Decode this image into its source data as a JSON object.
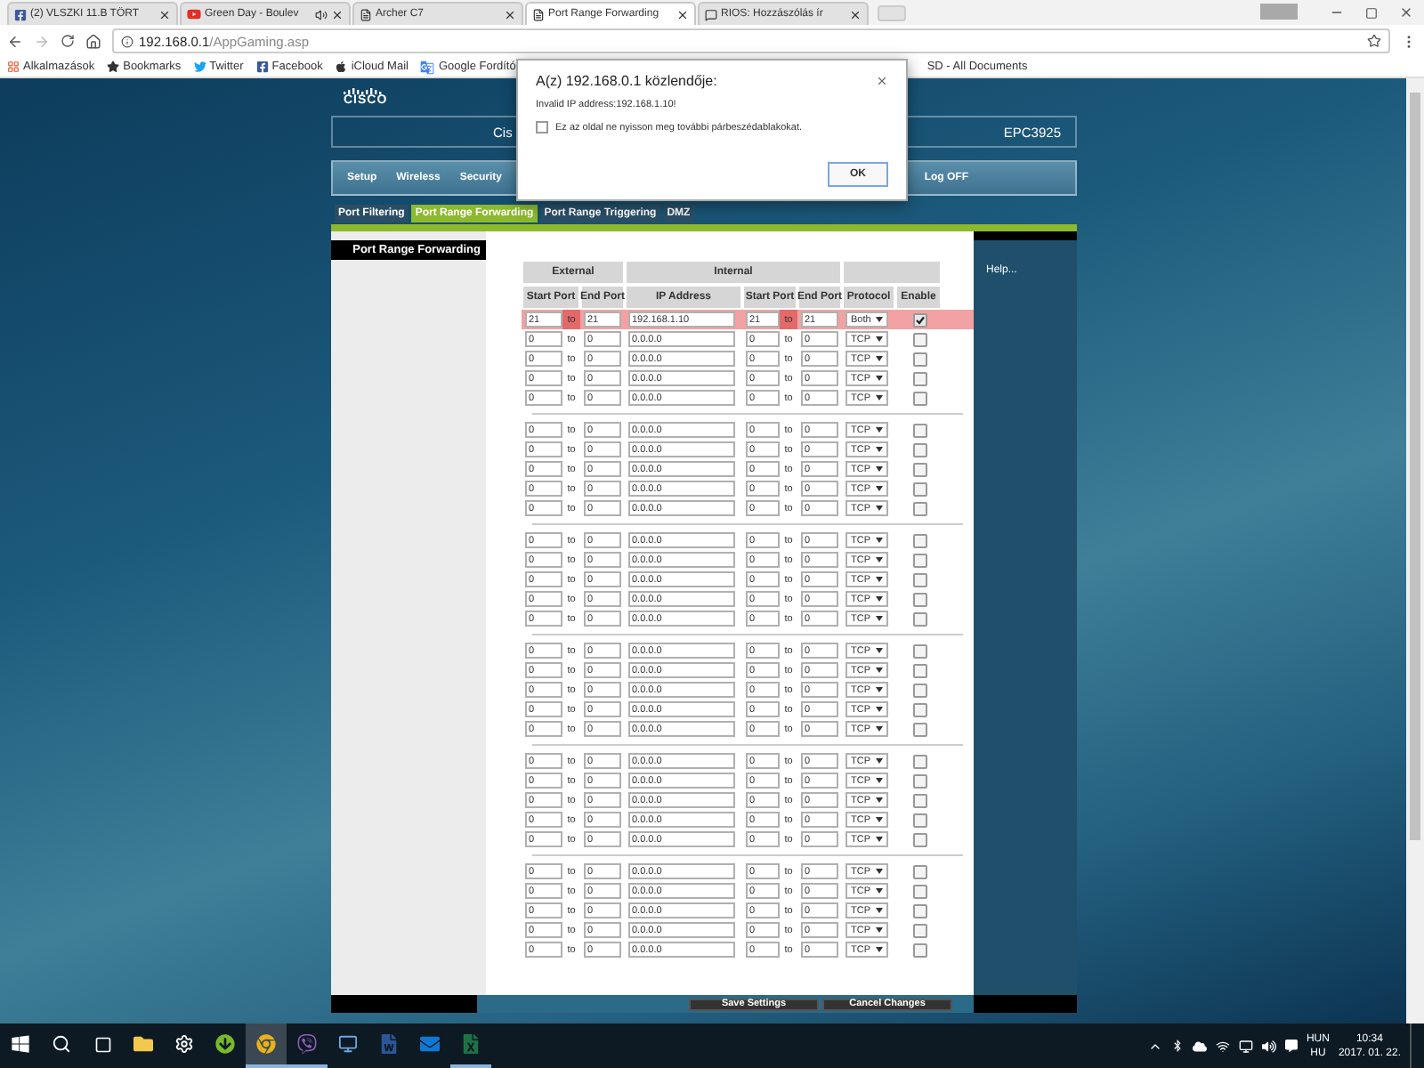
{
  "browser": {
    "tabs": [
      {
        "title": "(2) VLSZKI 11.B TÖRT",
        "audio": false,
        "selected": false
      },
      {
        "title": "Green Day - Boulev",
        "audio": true,
        "selected": false
      },
      {
        "title": "Archer C7",
        "audio": false,
        "selected": false
      },
      {
        "title": "Port Range Forwarding",
        "audio": false,
        "selected": true
      },
      {
        "title": "RIOS: Hozzászólás ír",
        "audio": false,
        "selected": false
      }
    ],
    "url": {
      "host": "192.168.0.1",
      "path": "/AppGaming.asp"
    },
    "bookmarks": [
      {
        "label": "Alkalmazások"
      },
      {
        "label": "Bookmarks"
      },
      {
        "label": "Twitter"
      },
      {
        "label": "Facebook"
      },
      {
        "label": "iCloud Mail"
      },
      {
        "label": "Google Fordító"
      }
    ],
    "bookmarks_after_dialog": [
      {
        "label": "SD - All Documents"
      }
    ]
  },
  "router": {
    "logo": "CISCO",
    "title": "Cis",
    "model": "EPC3925",
    "nav": [
      {
        "label": "Setup",
        "kind": "main"
      },
      {
        "label": "Wireless",
        "kind": "main"
      },
      {
        "label": "Security",
        "kind": "main"
      },
      {
        "label": "Log OFF",
        "kind": "logout"
      }
    ],
    "subtabs": [
      {
        "label": "Port Filtering",
        "selected": false
      },
      {
        "label": "Port Range Forwarding",
        "selected": true
      },
      {
        "label": "Port Range Triggering",
        "selected": false
      },
      {
        "label": "DMZ",
        "selected": false
      }
    ],
    "sidebar_title": "Port Range Forwarding",
    "help": "Help...",
    "table": {
      "groups_header": [
        "External",
        "Internal"
      ],
      "columns": [
        "Start Port",
        "End Port",
        "IP Address",
        "Start Port",
        "End Port",
        "Protocol",
        "Enable"
      ],
      "groups": [
        [
          {
            "ext_start": "21",
            "to_ext": "to",
            "ext_end": "21",
            "ip": "192.168.1.10",
            "int_start": "21",
            "to_int": "to",
            "int_end": "21",
            "protocol": "Both",
            "enabled": true,
            "invalid": true
          },
          {
            "ext_start": "0",
            "to_ext": "to",
            "ext_end": "0",
            "ip": "0.0.0.0",
            "int_start": "0",
            "to_int": "to",
            "int_end": "0",
            "protocol": "TCP",
            "enabled": false,
            "invalid": false
          },
          {
            "ext_start": "0",
            "to_ext": "to",
            "ext_end": "0",
            "ip": "0.0.0.0",
            "int_start": "0",
            "to_int": "to",
            "int_end": "0",
            "protocol": "TCP",
            "enabled": false,
            "invalid": false
          },
          {
            "ext_start": "0",
            "to_ext": "to",
            "ext_end": "0",
            "ip": "0.0.0.0",
            "int_start": "0",
            "to_int": "to",
            "int_end": "0",
            "protocol": "TCP",
            "enabled": false,
            "invalid": false
          },
          {
            "ext_start": "0",
            "to_ext": "to",
            "ext_end": "0",
            "ip": "0.0.0.0",
            "int_start": "0",
            "to_int": "to",
            "int_end": "0",
            "protocol": "TCP",
            "enabled": false,
            "invalid": false
          }
        ],
        [
          {
            "ext_start": "0",
            "to_ext": "to",
            "ext_end": "0",
            "ip": "0.0.0.0",
            "int_start": "0",
            "to_int": "to",
            "int_end": "0",
            "protocol": "TCP",
            "enabled": false,
            "invalid": false
          },
          {
            "ext_start": "0",
            "to_ext": "to",
            "ext_end": "0",
            "ip": "0.0.0.0",
            "int_start": "0",
            "to_int": "to",
            "int_end": "0",
            "protocol": "TCP",
            "enabled": false,
            "invalid": false
          },
          {
            "ext_start": "0",
            "to_ext": "to",
            "ext_end": "0",
            "ip": "0.0.0.0",
            "int_start": "0",
            "to_int": "to",
            "int_end": "0",
            "protocol": "TCP",
            "enabled": false,
            "invalid": false
          },
          {
            "ext_start": "0",
            "to_ext": "to",
            "ext_end": "0",
            "ip": "0.0.0.0",
            "int_start": "0",
            "to_int": "to",
            "int_end": "0",
            "protocol": "TCP",
            "enabled": false,
            "invalid": false
          },
          {
            "ext_start": "0",
            "to_ext": "to",
            "ext_end": "0",
            "ip": "0.0.0.0",
            "int_start": "0",
            "to_int": "to",
            "int_end": "0",
            "protocol": "TCP",
            "enabled": false,
            "invalid": false
          }
        ],
        [
          {
            "ext_start": "0",
            "to_ext": "to",
            "ext_end": "0",
            "ip": "0.0.0.0",
            "int_start": "0",
            "to_int": "to",
            "int_end": "0",
            "protocol": "TCP",
            "enabled": false,
            "invalid": false
          },
          {
            "ext_start": "0",
            "to_ext": "to",
            "ext_end": "0",
            "ip": "0.0.0.0",
            "int_start": "0",
            "to_int": "to",
            "int_end": "0",
            "protocol": "TCP",
            "enabled": false,
            "invalid": false
          },
          {
            "ext_start": "0",
            "to_ext": "to",
            "ext_end": "0",
            "ip": "0.0.0.0",
            "int_start": "0",
            "to_int": "to",
            "int_end": "0",
            "protocol": "TCP",
            "enabled": false,
            "invalid": false
          },
          {
            "ext_start": "0",
            "to_ext": "to",
            "ext_end": "0",
            "ip": "0.0.0.0",
            "int_start": "0",
            "to_int": "to",
            "int_end": "0",
            "protocol": "TCP",
            "enabled": false,
            "invalid": false
          },
          {
            "ext_start": "0",
            "to_ext": "to",
            "ext_end": "0",
            "ip": "0.0.0.0",
            "int_start": "0",
            "to_int": "to",
            "int_end": "0",
            "protocol": "TCP",
            "enabled": false,
            "invalid": false
          }
        ],
        [
          {
            "ext_start": "0",
            "to_ext": "to",
            "ext_end": "0",
            "ip": "0.0.0.0",
            "int_start": "0",
            "to_int": "to",
            "int_end": "0",
            "protocol": "TCP",
            "enabled": false,
            "invalid": false
          },
          {
            "ext_start": "0",
            "to_ext": "to",
            "ext_end": "0",
            "ip": "0.0.0.0",
            "int_start": "0",
            "to_int": "to",
            "int_end": "0",
            "protocol": "TCP",
            "enabled": false,
            "invalid": false
          },
          {
            "ext_start": "0",
            "to_ext": "to",
            "ext_end": "0",
            "ip": "0.0.0.0",
            "int_start": "0",
            "to_int": "to",
            "int_end": "0",
            "protocol": "TCP",
            "enabled": false,
            "invalid": false
          },
          {
            "ext_start": "0",
            "to_ext": "to",
            "ext_end": "0",
            "ip": "0.0.0.0",
            "int_start": "0",
            "to_int": "to",
            "int_end": "0",
            "protocol": "TCP",
            "enabled": false,
            "invalid": false
          },
          {
            "ext_start": "0",
            "to_ext": "to",
            "ext_end": "0",
            "ip": "0.0.0.0",
            "int_start": "0",
            "to_int": "to",
            "int_end": "0",
            "protocol": "TCP",
            "enabled": false,
            "invalid": false
          }
        ],
        [
          {
            "ext_start": "0",
            "to_ext": "to",
            "ext_end": "0",
            "ip": "0.0.0.0",
            "int_start": "0",
            "to_int": "to",
            "int_end": "0",
            "protocol": "TCP",
            "enabled": false,
            "invalid": false
          },
          {
            "ext_start": "0",
            "to_ext": "to",
            "ext_end": "0",
            "ip": "0.0.0.0",
            "int_start": "0",
            "to_int": "to",
            "int_end": "0",
            "protocol": "TCP",
            "enabled": false,
            "invalid": false
          },
          {
            "ext_start": "0",
            "to_ext": "to",
            "ext_end": "0",
            "ip": "0.0.0.0",
            "int_start": "0",
            "to_int": "to",
            "int_end": "0",
            "protocol": "TCP",
            "enabled": false,
            "invalid": false
          },
          {
            "ext_start": "0",
            "to_ext": "to",
            "ext_end": "0",
            "ip": "0.0.0.0",
            "int_start": "0",
            "to_int": "to",
            "int_end": "0",
            "protocol": "TCP",
            "enabled": false,
            "invalid": false
          },
          {
            "ext_start": "0",
            "to_ext": "to",
            "ext_end": "0",
            "ip": "0.0.0.0",
            "int_start": "0",
            "to_int": "to",
            "int_end": "0",
            "protocol": "TCP",
            "enabled": false,
            "invalid": false
          }
        ],
        [
          {
            "ext_start": "0",
            "to_ext": "to",
            "ext_end": "0",
            "ip": "0.0.0.0",
            "int_start": "0",
            "to_int": "to",
            "int_end": "0",
            "protocol": "TCP",
            "enabled": false,
            "invalid": false
          },
          {
            "ext_start": "0",
            "to_ext": "to",
            "ext_end": "0",
            "ip": "0.0.0.0",
            "int_start": "0",
            "to_int": "to",
            "int_end": "0",
            "protocol": "TCP",
            "enabled": false,
            "invalid": false
          },
          {
            "ext_start": "0",
            "to_ext": "to",
            "ext_end": "0",
            "ip": "0.0.0.0",
            "int_start": "0",
            "to_int": "to",
            "int_end": "0",
            "protocol": "TCP",
            "enabled": false,
            "invalid": false
          },
          {
            "ext_start": "0",
            "to_ext": "to",
            "ext_end": "0",
            "ip": "0.0.0.0",
            "int_start": "0",
            "to_int": "to",
            "int_end": "0",
            "protocol": "TCP",
            "enabled": false,
            "invalid": false
          },
          {
            "ext_start": "0",
            "to_ext": "to",
            "ext_end": "0",
            "ip": "0.0.0.0",
            "int_start": "0",
            "to_int": "to",
            "int_end": "0",
            "protocol": "TCP",
            "enabled": false,
            "invalid": false
          }
        ]
      ]
    },
    "buttons": [
      "Save Settings",
      "Cancel Changes"
    ]
  },
  "dialog": {
    "title": "A(z) 192.168.0.1 közlendője:",
    "message": "Invalid IP address:192.168.1.10!",
    "checkbox": {
      "label": "Ez az oldal ne nyisson meg további párbeszédablakokat.",
      "checked": false
    },
    "button": "OK"
  },
  "taskbar": {
    "apps": [
      {
        "kind": "folder",
        "active": false,
        "running": false
      },
      {
        "kind": "gear",
        "active": false,
        "running": false
      },
      {
        "kind": "torrent",
        "active": false,
        "running": false
      },
      {
        "kind": "browser",
        "active": true,
        "running": true
      },
      {
        "kind": "chat",
        "active": false,
        "running": true
      },
      {
        "kind": "computer",
        "active": false,
        "running": false
      },
      {
        "kind": "word",
        "active": false,
        "running": false
      },
      {
        "kind": "mail",
        "active": false,
        "running": false
      },
      {
        "kind": "excel",
        "active": false,
        "running": true
      }
    ],
    "language": "HUN",
    "layout": "HU",
    "time": "10:34",
    "date": "2017. 01. 22."
  }
}
